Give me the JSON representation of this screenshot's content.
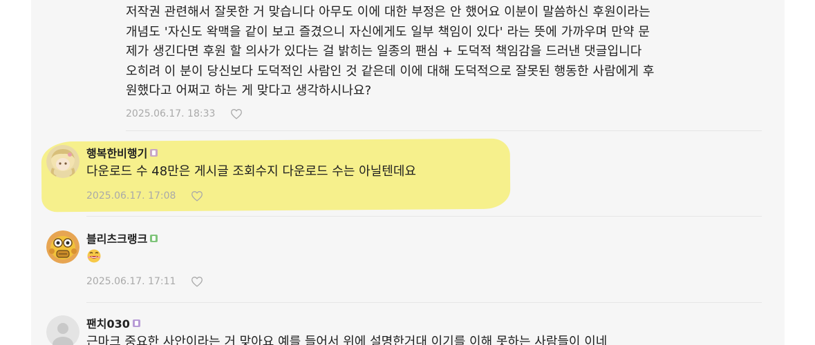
{
  "reply": {
    "lines": [
      "저작권 관련해서 잘못한 거 맞습니다 아무도 이에 대한 부정은 안 했어요 이분이 말씀하신 후원이라는",
      "개념도 '자신도 왁맥을 같이 보고 즐겼으니 자신에게도 일부 책임이 있다' 라는 뜻에 가까우며 만약 문",
      "제가 생긴다면 후원 할 의사가 있다는 걸 밝히는 일종의 팬심 + 도덕적 책임감을 드러낸 댓글입니다",
      "오히려 이 분이 당신보다 도덕적인 사람인 것 같은데 이에 대해 도덕적으로 잘못된 행동한 사람에게 후",
      "원했다고 어쩌고 하는 게 맞다고 생각하시나요?"
    ],
    "date": "2025.06.17. 18:33",
    "like_icon": "heart-outline-icon"
  },
  "comments": [
    {
      "nickname": "행복한비행기",
      "badge_color": "#c9a7c4",
      "text": "다운로드 수 48만은 게시글 조회수지 다운로드 수는 아닐텐데요",
      "date": "2025.06.17. 17:08",
      "avatar": "avatar-blonde-character",
      "highlight_color": "#f6ef86"
    },
    {
      "nickname": "블리츠크랭크",
      "badge_color": "#7fc47a",
      "emoji": "laughing-emoji",
      "date": "2025.06.17. 17:11",
      "avatar": "avatar-yellow-robot"
    },
    {
      "nickname": "팬치030",
      "badge_color": "#b79bd6",
      "text": "근마크 중요한 사안이라는 거 맞아요 예를 들어서 위에 설명한거대 이기를 이해 못하는 사람들이 이네",
      "avatar": "avatar-default-gray"
    }
  ],
  "colors": {
    "panel_bg": "#f6f6f6",
    "meta_text": "#a9a9a9",
    "divider": "#e6e6e6"
  }
}
